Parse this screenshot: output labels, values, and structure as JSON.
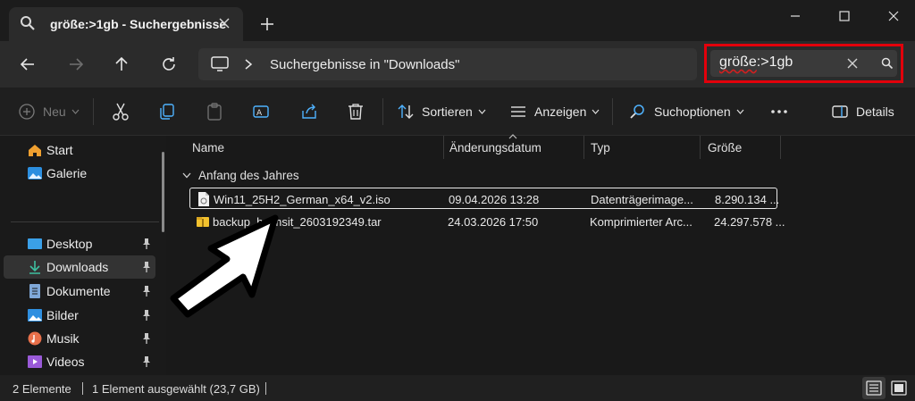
{
  "tab": {
    "title": "größe:>1gb - Suchergebnisse"
  },
  "address": {
    "breadcrumb": "Suchergebnisse in \"Downloads\""
  },
  "search": {
    "query_part1": "größe",
    "query_part2": ":>1gb"
  },
  "toolbar": {
    "new_label": "Neu",
    "sort_label": "Sortieren",
    "view_label": "Anzeigen",
    "search_options_label": "Suchoptionen",
    "details_label": "Details"
  },
  "sidebar": {
    "items": [
      {
        "label": "Start",
        "icon": "home-icon"
      },
      {
        "label": "Galerie",
        "icon": "gallery-icon"
      },
      {
        "label": "Desktop",
        "icon": "desktop-icon"
      },
      {
        "label": "Downloads",
        "icon": "downloads-icon"
      },
      {
        "label": "Dokumente",
        "icon": "documents-icon"
      },
      {
        "label": "Bilder",
        "icon": "pictures-icon"
      },
      {
        "label": "Musik",
        "icon": "music-icon"
      },
      {
        "label": "Videos",
        "icon": "videos-icon"
      }
    ]
  },
  "columns": {
    "name": "Name",
    "date": "Änderungsdatum",
    "type": "Typ",
    "size": "Größe"
  },
  "group": {
    "label": "Anfang des Jahres"
  },
  "files": [
    {
      "name": "Win11_25H2_German_x64_v2.iso",
      "date": "09.04.2026 13:28",
      "type": "Datenträgerimage...",
      "size": "8.290.134 ..."
    },
    {
      "name": "backup_heimsit_2603192349.tar",
      "date": "24.03.2026 17:50",
      "type": "Komprimierter Arc...",
      "size": "24.297.578 ..."
    }
  ],
  "status": {
    "count": "2 Elemente",
    "selection": "1 Element ausgewählt (23,7 GB)"
  },
  "colors": {
    "accent_highlight": "#e3000b",
    "folder": "#f2c12e"
  }
}
